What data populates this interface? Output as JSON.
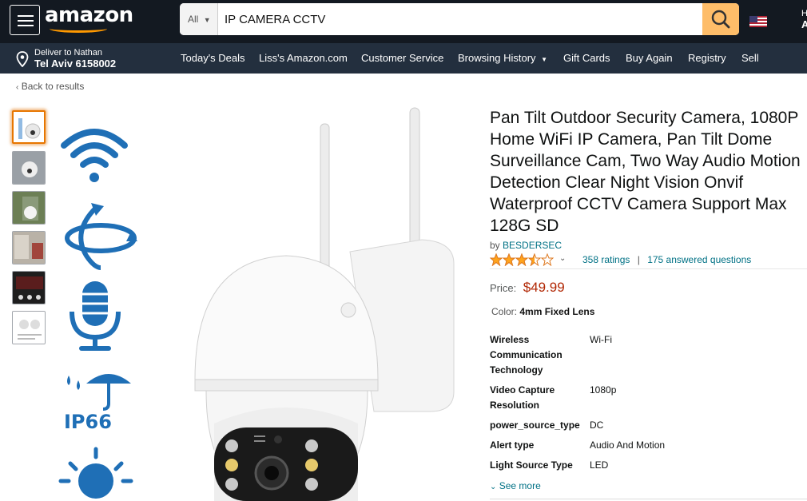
{
  "header": {
    "logo": "amazon",
    "search": {
      "category": "All",
      "query": "IP CAMERA CCTV"
    },
    "account_partial": {
      "line1": "H",
      "line2": "A"
    }
  },
  "nav": {
    "deliver_to": "Deliver to Nathan",
    "location": "Tel Aviv 6158002",
    "links": [
      "Today's Deals",
      "Liss's Amazon.com",
      "Customer Service",
      "Browsing History",
      "Gift Cards",
      "Buy Again",
      "Registry",
      "Sell"
    ]
  },
  "back_link": "Back to results",
  "feature_icons": [
    "wifi-icon",
    "rotation-icon",
    "microphone-icon",
    "ip66-waterproof-icon",
    "sun-icon"
  ],
  "feature_text": {
    "ip66": "IP66"
  },
  "product": {
    "title": "Pan Tilt Outdoor Security Camera, 1080P Home WiFi IP Camera, Pan Tilt Dome Surveillance Cam, Two Way Audio Motion Detection Clear Night Vision Onvif Waterproof CCTV Camera Support Max 128G SD",
    "by_label": "by",
    "brand": "BESDERSEC",
    "rating": 3.5,
    "ratings_text": "358 ratings",
    "answered_text": "175 answered questions",
    "price_label": "Price:",
    "price": "$49.99",
    "color_label": "Color:",
    "color_value": "4mm Fixed Lens",
    "specs": [
      {
        "key": "Wireless Communication Technology",
        "value": "Wi-Fi"
      },
      {
        "key": "Video Capture Resolution",
        "value": "1080p"
      },
      {
        "key": "power_source_type",
        "value": "DC"
      },
      {
        "key": "Alert type",
        "value": "Audio And Motion"
      },
      {
        "key": "Light Source Type",
        "value": "LED"
      }
    ],
    "see_more": "See more"
  },
  "colors": {
    "nav_dark": "#131921",
    "nav_secondary": "#232f3e",
    "accent": "#febd69",
    "link": "#007185",
    "price": "#b12704",
    "icon_blue": "#1f6fb6"
  }
}
